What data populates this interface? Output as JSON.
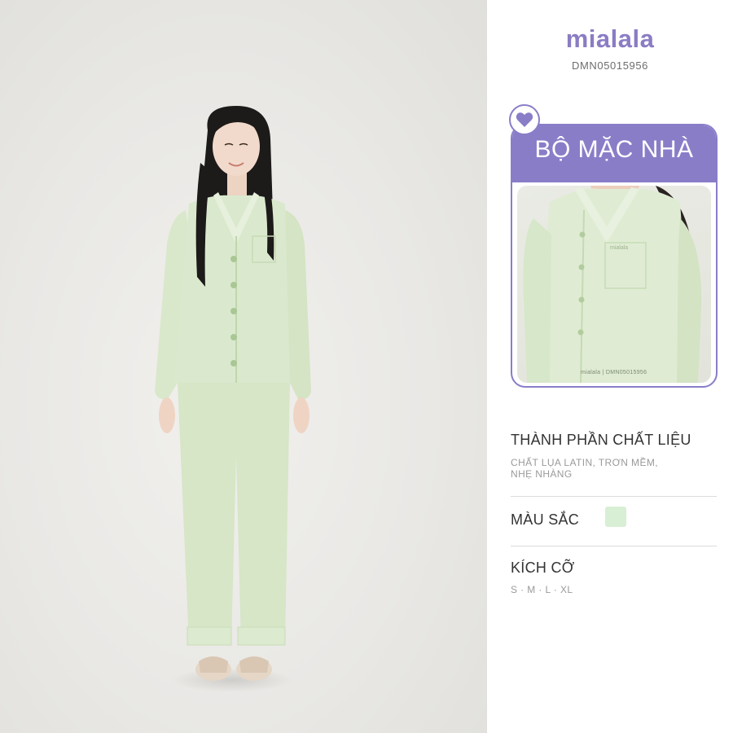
{
  "brand": {
    "logo_text": "mialala",
    "sku": "DMN05015956"
  },
  "card": {
    "title": "BỘ MẶC NHÀ",
    "caption": "mialala | DMN05015956"
  },
  "icons": {
    "heart": "heart-icon"
  },
  "details": {
    "material_title": "THÀNH PHẦN CHẤT LIỆU",
    "material_line1": "CHẤT LỤA LATIN,  TRƠN MỀM,",
    "material_line2": "NHẸ NHÀNG",
    "color_title": "MÀU SẮC",
    "color_value": "#d8efd5",
    "size_title": "KÍCH CỠ",
    "sizes": "S · M · L · XL"
  },
  "colors": {
    "accent": "#8a7dc8",
    "garment": "#d6e6c7"
  }
}
